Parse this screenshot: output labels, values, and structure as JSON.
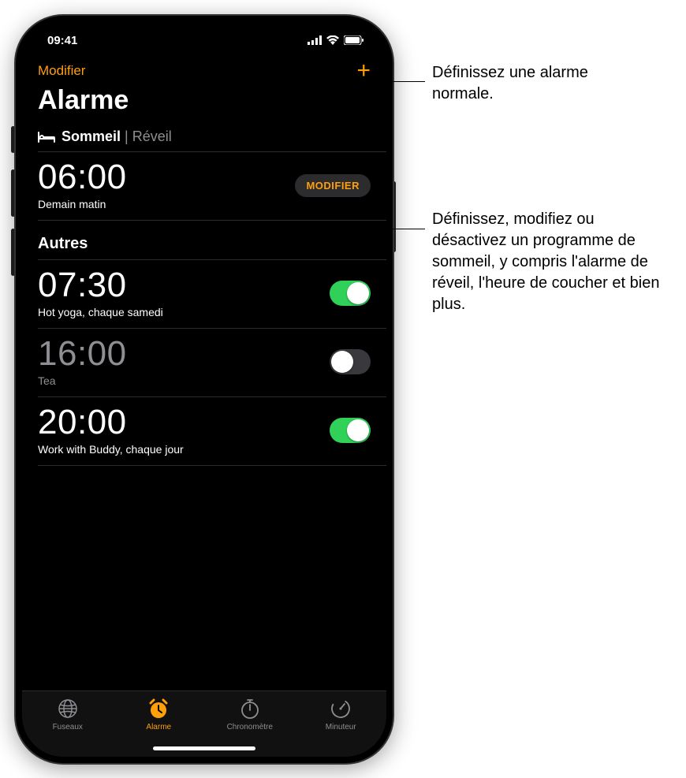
{
  "status": {
    "time": "09:41"
  },
  "nav": {
    "edit": "Modifier",
    "add": "+"
  },
  "title": "Alarme",
  "sleep_section": {
    "sleep_label": "Sommeil",
    "wake_label": "Réveil",
    "time": "06:00",
    "subtitle": "Demain matin",
    "modify_button": "MODIFIER"
  },
  "others_header": "Autres",
  "alarms": [
    {
      "time": "07:30",
      "subtitle": "Hot yoga, chaque samedi",
      "enabled": true
    },
    {
      "time": "16:00",
      "subtitle": "Tea",
      "enabled": false
    },
    {
      "time": "20:00",
      "subtitle": "Work with Buddy, chaque jour",
      "enabled": true
    }
  ],
  "tabs": [
    {
      "label": "Fuseaux",
      "icon": "globe-icon",
      "active": false
    },
    {
      "label": "Alarme",
      "icon": "alarm-icon",
      "active": true
    },
    {
      "label": "Chronomètre",
      "icon": "stopwatch-icon",
      "active": false
    },
    {
      "label": "Minuteur",
      "icon": "timer-icon",
      "active": false
    }
  ],
  "callouts": {
    "add": "Définissez une alarme normale.",
    "modify": "Définissez, modifiez ou désactivez un programme de sommeil, y compris l'alarme de réveil, l'heure de coucher et bien plus."
  },
  "colors": {
    "accent": "#ff9f0a",
    "switch_on": "#30d158",
    "inactive_text": "#8e8e93"
  }
}
